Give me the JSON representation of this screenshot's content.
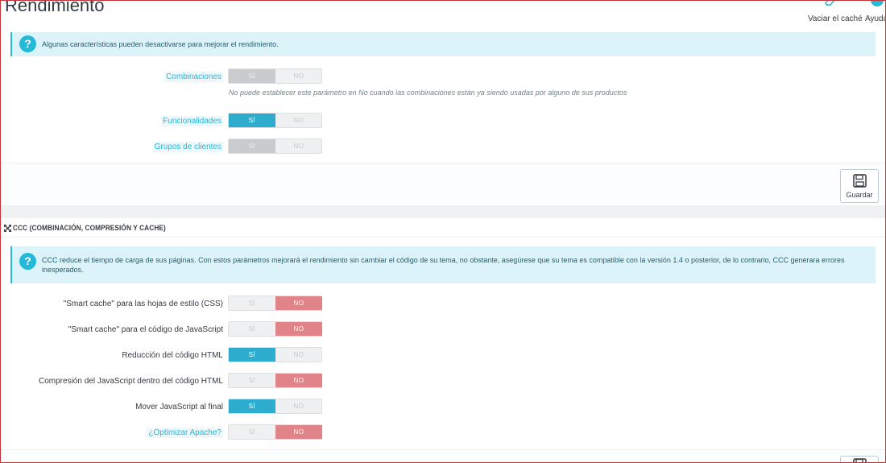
{
  "header": {
    "title": "Rendimiento",
    "clear_cache_label": "Vaciar el caché",
    "help_label": "Ayuda"
  },
  "debug_panel": {
    "alert": "Algunas características pueden desactivarse para mejorar el rendimiento.",
    "rows": [
      {
        "label": "Combinaciones",
        "state": "yes-disabled",
        "yes": "SÍ",
        "no": "NO",
        "help": "No puede establecer este parámetro en No cuando las combinaciones están ya siendo usadas por alguno de sus productos"
      },
      {
        "label": "Funcionalidades",
        "state": "yes",
        "yes": "SÍ",
        "no": "NO"
      },
      {
        "label": "Grupos de clientes",
        "state": "yes-disabled",
        "yes": "SÍ",
        "no": "NO"
      }
    ],
    "save_label": "Guardar"
  },
  "ccc_panel": {
    "heading": "CCC (COMBINACIÓN, COMPRESIÓN Y CACHE)",
    "alert": "CCC reduce el tiempo de carga de sus páginas. Con estos parámetros mejorará el rendimiento sin cambiar el código de su tema, no obstante, asegúrese que su tema es compatible con la versión 1.4 o posterior, de lo contrario, CCC generara errores inesperados.",
    "rows": [
      {
        "label": "\"Smart cache\" para las hojas de estilo (CSS)",
        "state": "no",
        "yes": "SÍ",
        "no": "NO"
      },
      {
        "label": "\"Smart cache\" para el código de JavaScript",
        "state": "no",
        "yes": "SÍ",
        "no": "NO"
      },
      {
        "label": "Reducción del código HTML",
        "state": "yes",
        "yes": "SÍ",
        "no": "NO"
      },
      {
        "label": "Compresión del JavaScript dentro del código HTML",
        "state": "no",
        "yes": "SÍ",
        "no": "NO"
      },
      {
        "label": "Mover JavaScript al final",
        "state": "yes",
        "yes": "SÍ",
        "no": "NO"
      },
      {
        "label": "¿Optimizar Apache?",
        "state": "no",
        "yes": "SÍ",
        "no": "NO"
      }
    ]
  },
  "colors": {
    "accent": "#25b9d7",
    "switch_on": "#2eacce",
    "switch_off_red": "#e08489",
    "switch_disabled": "#c8ccce"
  }
}
